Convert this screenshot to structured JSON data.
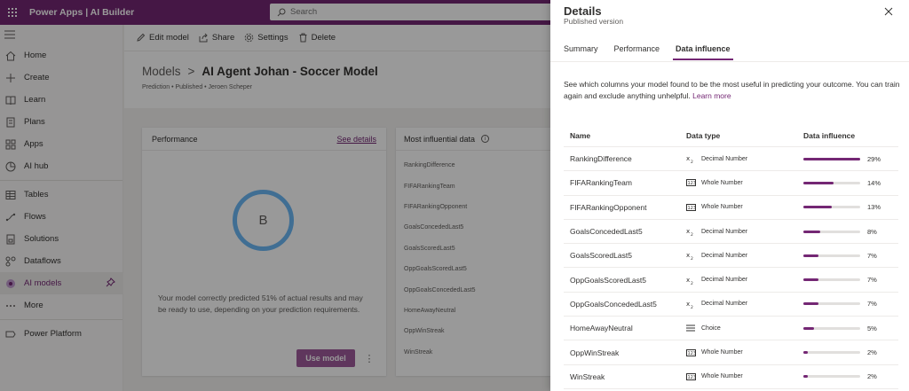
{
  "topbar": {
    "app_title": "Power Apps | AI Builder",
    "search_placeholder": "Search"
  },
  "sidebar": {
    "items": [
      {
        "label": "Home",
        "icon": "home-icon"
      },
      {
        "label": "Create",
        "icon": "plus-icon"
      },
      {
        "label": "Learn",
        "icon": "book-icon"
      },
      {
        "label": "Plans",
        "icon": "plans-icon"
      },
      {
        "label": "Apps",
        "icon": "apps-icon"
      },
      {
        "label": "AI hub",
        "icon": "ai-hub-icon"
      },
      {
        "label": "Tables",
        "icon": "table-icon"
      },
      {
        "label": "Flows",
        "icon": "flow-icon"
      },
      {
        "label": "Solutions",
        "icon": "solutions-icon"
      },
      {
        "label": "Dataflows",
        "icon": "dataflow-icon"
      },
      {
        "label": "AI models",
        "icon": "ai-models-icon"
      },
      {
        "label": "More",
        "icon": "more-icon"
      },
      {
        "label": "Power Platform",
        "icon": "power-platform-icon"
      }
    ]
  },
  "commands": {
    "edit": "Edit model",
    "share": "Share",
    "settings": "Settings",
    "delete": "Delete"
  },
  "header": {
    "breadcrumb_root": "Models",
    "breadcrumb_sep": ">",
    "model_name": "AI Agent Johan - Soccer Model",
    "subtitle": "Prediction • Published • Jeroen Scheper"
  },
  "performance_card": {
    "title": "Performance",
    "see_details": "See details",
    "grade": "B",
    "description": "Your model correctly predicted 51% of actual results and may be ready to use, depending on your prediction requirements.",
    "use_model": "Use model",
    "more": "⋮"
  },
  "influential_card": {
    "title": "Most influential data",
    "items": [
      "RankingDifference",
      "FIFARankingTeam",
      "FIFARankingOpponent",
      "GoalsConcededLast5",
      "GoalsScoredLast5",
      "OppGoalsScoredLast5",
      "OppGoalsConcededLast5",
      "HomeAwayNeutral",
      "OppWinStreak",
      "WinStreak"
    ]
  },
  "panel": {
    "title": "Details",
    "subtitle": "Published version",
    "tabs": [
      "Summary",
      "Performance",
      "Data influence"
    ],
    "active_tab": "Data influence",
    "description": "See which columns your model found to be the most useful in predicting your outcome. You can train again and exclude anything unhelpful.",
    "learn_more": "Learn more",
    "columns": {
      "name": "Name",
      "type": "Data type",
      "influence": "Data influence"
    },
    "rows": [
      {
        "name": "RankingDifference",
        "type": "Decimal Number",
        "type_icon": "decimal-icon",
        "influence": 29,
        "influence_label": "29%"
      },
      {
        "name": "FIFARankingTeam",
        "type": "Whole Number",
        "type_icon": "whole-number-icon",
        "influence": 14,
        "influence_label": "14%"
      },
      {
        "name": "FIFARankingOpponent",
        "type": "Whole Number",
        "type_icon": "whole-number-icon",
        "influence": 13,
        "influence_label": "13%"
      },
      {
        "name": "GoalsConcededLast5",
        "type": "Decimal Number",
        "type_icon": "decimal-icon",
        "influence": 8,
        "influence_label": "8%"
      },
      {
        "name": "GoalsScoredLast5",
        "type": "Decimal Number",
        "type_icon": "decimal-icon",
        "influence": 7,
        "influence_label": "7%"
      },
      {
        "name": "OppGoalsScoredLast5",
        "type": "Decimal Number",
        "type_icon": "decimal-icon",
        "influence": 7,
        "influence_label": "7%"
      },
      {
        "name": "OppGoalsConcededLast5",
        "type": "Decimal Number",
        "type_icon": "decimal-icon",
        "influence": 7,
        "influence_label": "7%"
      },
      {
        "name": "HomeAwayNeutral",
        "type": "Choice",
        "type_icon": "choice-icon",
        "influence": 5,
        "influence_label": "5%"
      },
      {
        "name": "OppWinStreak",
        "type": "Whole Number",
        "type_icon": "whole-number-icon",
        "influence": 2,
        "influence_label": "2%"
      },
      {
        "name": "WinStreak",
        "type": "Whole Number",
        "type_icon": "whole-number-icon",
        "influence": 2,
        "influence_label": "2%"
      }
    ]
  },
  "colors": {
    "brand": "#742774",
    "grade_ring": "#6cb8f6",
    "use_model_button": "#9e5a9b"
  }
}
